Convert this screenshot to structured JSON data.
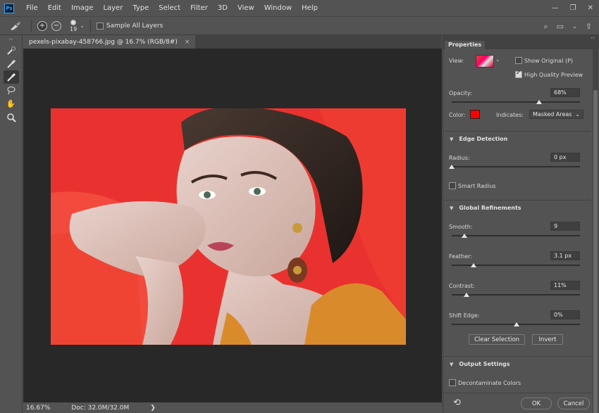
{
  "app": {
    "logo": "Ps"
  },
  "menu": [
    "File",
    "Edit",
    "Image",
    "Layer",
    "Type",
    "Select",
    "Filter",
    "3D",
    "View",
    "Window",
    "Help"
  ],
  "window_controls": {
    "minimize": "—",
    "restore": "❐",
    "close": "✕"
  },
  "options": {
    "brush_size": "19",
    "sample_all_layers_label": "Sample All Layers",
    "sample_all_layers_checked": false
  },
  "document": {
    "tab_title": "pexels-pixabay-458766.jpg @ 16.7% (RGB/8#)",
    "tab_close": "×"
  },
  "status": {
    "zoom": "16.67%",
    "doc": "Doc: 32.0M/32.0M",
    "arrow": "❯"
  },
  "properties": {
    "tab_label": "Properties",
    "view_label": "View:",
    "show_original_label": "Show Original (P)",
    "show_original_checked": false,
    "high_quality_label": "High Quality Preview",
    "high_quality_checked": true,
    "opacity_label": "Opacity:",
    "opacity_value": "68%",
    "color_label": "Color:",
    "color_hex": "#ff0000",
    "indicates_label": "Indicates:",
    "indicates_value": "Masked Areas",
    "edge_detection": {
      "title": "Edge Detection",
      "radius_label": "Radius:",
      "radius_value": "0 px",
      "smart_radius_label": "Smart Radius",
      "smart_radius_checked": false
    },
    "global_refinements": {
      "title": "Global Refinements",
      "smooth_label": "Smooth:",
      "smooth_value": "9",
      "feather_label": "Feather:",
      "feather_value": "3.1 px",
      "contrast_label": "Contrast:",
      "contrast_value": "11%",
      "shift_edge_label": "Shift Edge:",
      "shift_edge_value": "0%"
    },
    "clear_selection_label": "Clear Selection",
    "invert_label": "Invert",
    "output_settings": {
      "title": "Output Settings",
      "decontaminate_label": "Decontaminate Colors"
    },
    "ok_label": "OK",
    "cancel_label": "Cancel"
  },
  "colors": {
    "accent_red": "#e9322f",
    "panel_bg": "#535353",
    "canvas_bg": "#282828"
  }
}
